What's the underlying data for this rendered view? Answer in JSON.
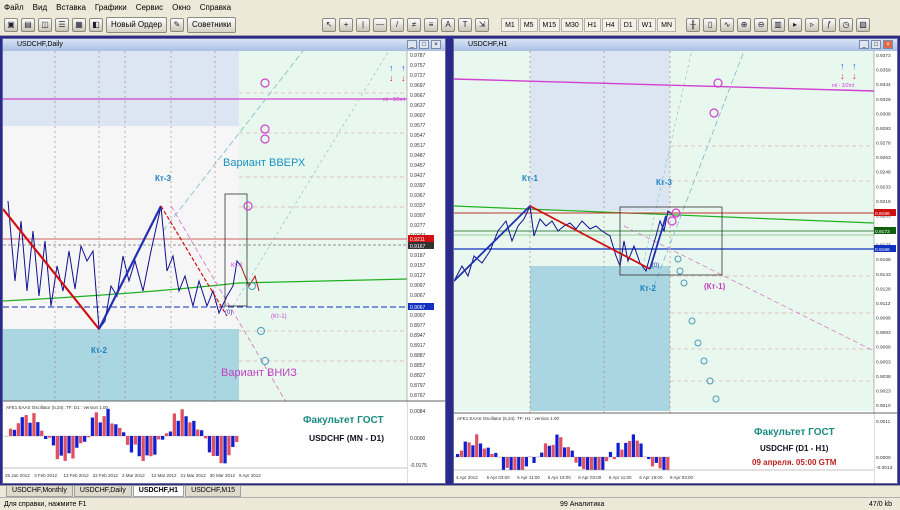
{
  "menu": [
    "Файл",
    "Вид",
    "Вставка",
    "Графики",
    "Сервис",
    "Окно",
    "Справка"
  ],
  "toolbar": {
    "new_order": "Новый Ордер",
    "advisors": "Советники",
    "timeframes": [
      "M1",
      "M5",
      "M15",
      "M30",
      "H1",
      "H4",
      "D1",
      "W1",
      "MN"
    ]
  },
  "left": {
    "title": "USDCHF,Daily",
    "annotations": {
      "kt3": "Кт-3",
      "kt2": "Кт-2",
      "kt1_neg": "(Кт-1)",
      "kt_zero": "(0)",
      "kt2_small": "Кт-2",
      "up": "Вариант ВВЕРХ",
      "down": "Вариант ВНИЗ",
      "faculty": "Факультет ГОСТ",
      "pair": "USDCHF (MN - D1)",
      "ml": "ml - 3/2ml",
      "ml_small": "ml",
      "kt_small": "Кт-3",
      "osc_label": "AFE1 EAAS Oscillator (5,34). TF: D1 : version 1.00"
    },
    "prices": [
      "0.9787",
      "0.9757",
      "0.9727",
      "0.9697",
      "0.9667",
      "0.9637",
      "0.9607",
      "0.9577",
      "0.9547",
      "0.9517",
      "0.9487",
      "0.9457",
      "0.9427",
      "0.9397",
      "0.9367",
      "0.9337",
      "0.9307",
      "0.9277",
      "0.9247",
      "0.9217",
      "0.9187",
      "0.9157",
      "0.9127",
      "0.9097",
      "0.9067",
      "0.9037",
      "0.9007",
      "0.8977",
      "0.8947",
      "0.8917",
      "0.8887",
      "0.8857",
      "0.8827",
      "0.8797",
      "0.8767"
    ],
    "price_tags": [
      "0.9211",
      "0.9167",
      "0.9067"
    ],
    "osc_scale": [
      "0.0084",
      "0.0000",
      "-0.0175"
    ],
    "dates": [
      "25 Jan 2012",
      "3 Feb 2012",
      "13 Feb 2012",
      "22 Feb 2012",
      "2 Mar 2012",
      "12 Mar 2012",
      "21 Mar 2012",
      "30 Mar 2012",
      "9 Apr 2012"
    ]
  },
  "right": {
    "title": "USDCHF,H1",
    "annotations": {
      "kt1": "Кт-1",
      "kt3": "Кт-3",
      "kt2": "Кт-2",
      "kt1_neg": "(Кт-1)",
      "kt_zero": "(0)",
      "faculty": "Факультет ГОСТ",
      "pair": "USDCHF (D1 - H1)",
      "date": "09 апреля. 05:00 GTM",
      "ml": "ml - 3/2ml",
      "osc_label": "AFE1 EAAS Oscillator (5,34). TF: H1 : version 1.00"
    },
    "prices": [
      "0.9373",
      "0.9359",
      "0.9344",
      "0.9329",
      "0.9308",
      "0.9293",
      "0.9278",
      "0.9263",
      "0.9248",
      "0.9233",
      "0.9218",
      "0.9203",
      "0.9188",
      "0.9173",
      "0.9158",
      "0.9143",
      "0.9128",
      "0.9113",
      "0.9098",
      "0.9083",
      "0.9068",
      "0.9053",
      "0.9038",
      "0.9023",
      "0.9010"
    ],
    "price_tags": [
      "0.9196",
      "0.9173",
      "0.9166"
    ],
    "osc_scale": [
      "0.0011",
      "0.0000",
      "-0.0013"
    ],
    "dates": [
      "4 Apr 2012",
      "5 Apr 03:00",
      "5 Apr 11:00",
      "5 Apr 19:00",
      "6 Apr 03:00",
      "6 Apr 11:00",
      "6 Apr 19:00",
      "9 Apr 03:00"
    ]
  },
  "tabs": [
    "USDCHF,Monthly",
    "USDCHF,Daily",
    "USDCHF,H1",
    "USDCHF,M15"
  ],
  "active_tab": "USDCHF,H1",
  "status": {
    "help": "Для справки, нажмите F1",
    "profile": "99 Аналитика",
    "traffic": "47/0 kb"
  },
  "colors": {
    "zone_blue": "#dce6f2",
    "zone_teal": "#a9d6e0",
    "zone_green": "#e9f8ef",
    "pitchfork": "#2030b0",
    "trend_red": "#d01010",
    "magenta": "#d040d0",
    "osc_blue": "#1020d0",
    "osc_red": "#e05060",
    "faculty_teal": "#1a8a80"
  }
}
